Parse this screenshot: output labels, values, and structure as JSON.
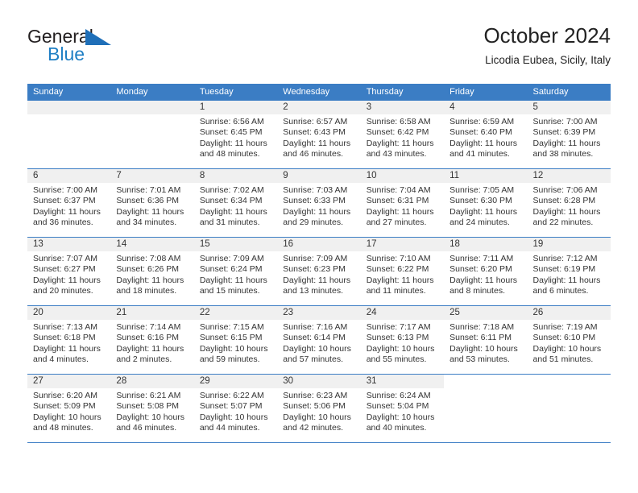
{
  "brand": {
    "word_one": "General",
    "word_two": "Blue",
    "triangle_icon": "triangle-icon"
  },
  "header": {
    "title": "October 2024",
    "subtitle": "Licodia Eubea, Sicily, Italy"
  },
  "colors": {
    "header_blue": "#3b7dc4",
    "brand_blue": "#1f7fc4",
    "daynum_band": "#f0f0f0",
    "text": "#333333"
  },
  "weekday_headers": [
    "Sunday",
    "Monday",
    "Tuesday",
    "Wednesday",
    "Thursday",
    "Friday",
    "Saturday"
  ],
  "labels": {
    "sunrise_prefix": "Sunrise: ",
    "sunset_prefix": "Sunset: ",
    "daylight_prefix": "Daylight: "
  },
  "weeks": [
    [
      {
        "day": "",
        "empty": true
      },
      {
        "day": "",
        "empty": true
      },
      {
        "day": "1",
        "sunrise": "Sunrise: 6:56 AM",
        "sunset": "Sunset: 6:45 PM",
        "daylight": "Daylight: 11 hours and 48 minutes."
      },
      {
        "day": "2",
        "sunrise": "Sunrise: 6:57 AM",
        "sunset": "Sunset: 6:43 PM",
        "daylight": "Daylight: 11 hours and 46 minutes."
      },
      {
        "day": "3",
        "sunrise": "Sunrise: 6:58 AM",
        "sunset": "Sunset: 6:42 PM",
        "daylight": "Daylight: 11 hours and 43 minutes."
      },
      {
        "day": "4",
        "sunrise": "Sunrise: 6:59 AM",
        "sunset": "Sunset: 6:40 PM",
        "daylight": "Daylight: 11 hours and 41 minutes."
      },
      {
        "day": "5",
        "sunrise": "Sunrise: 7:00 AM",
        "sunset": "Sunset: 6:39 PM",
        "daylight": "Daylight: 11 hours and 38 minutes."
      }
    ],
    [
      {
        "day": "6",
        "sunrise": "Sunrise: 7:00 AM",
        "sunset": "Sunset: 6:37 PM",
        "daylight": "Daylight: 11 hours and 36 minutes."
      },
      {
        "day": "7",
        "sunrise": "Sunrise: 7:01 AM",
        "sunset": "Sunset: 6:36 PM",
        "daylight": "Daylight: 11 hours and 34 minutes."
      },
      {
        "day": "8",
        "sunrise": "Sunrise: 7:02 AM",
        "sunset": "Sunset: 6:34 PM",
        "daylight": "Daylight: 11 hours and 31 minutes."
      },
      {
        "day": "9",
        "sunrise": "Sunrise: 7:03 AM",
        "sunset": "Sunset: 6:33 PM",
        "daylight": "Daylight: 11 hours and 29 minutes."
      },
      {
        "day": "10",
        "sunrise": "Sunrise: 7:04 AM",
        "sunset": "Sunset: 6:31 PM",
        "daylight": "Daylight: 11 hours and 27 minutes."
      },
      {
        "day": "11",
        "sunrise": "Sunrise: 7:05 AM",
        "sunset": "Sunset: 6:30 PM",
        "daylight": "Daylight: 11 hours and 24 minutes."
      },
      {
        "day": "12",
        "sunrise": "Sunrise: 7:06 AM",
        "sunset": "Sunset: 6:28 PM",
        "daylight": "Daylight: 11 hours and 22 minutes."
      }
    ],
    [
      {
        "day": "13",
        "sunrise": "Sunrise: 7:07 AM",
        "sunset": "Sunset: 6:27 PM",
        "daylight": "Daylight: 11 hours and 20 minutes."
      },
      {
        "day": "14",
        "sunrise": "Sunrise: 7:08 AM",
        "sunset": "Sunset: 6:26 PM",
        "daylight": "Daylight: 11 hours and 18 minutes."
      },
      {
        "day": "15",
        "sunrise": "Sunrise: 7:09 AM",
        "sunset": "Sunset: 6:24 PM",
        "daylight": "Daylight: 11 hours and 15 minutes."
      },
      {
        "day": "16",
        "sunrise": "Sunrise: 7:09 AM",
        "sunset": "Sunset: 6:23 PM",
        "daylight": "Daylight: 11 hours and 13 minutes."
      },
      {
        "day": "17",
        "sunrise": "Sunrise: 7:10 AM",
        "sunset": "Sunset: 6:22 PM",
        "daylight": "Daylight: 11 hours and 11 minutes."
      },
      {
        "day": "18",
        "sunrise": "Sunrise: 7:11 AM",
        "sunset": "Sunset: 6:20 PM",
        "daylight": "Daylight: 11 hours and 8 minutes."
      },
      {
        "day": "19",
        "sunrise": "Sunrise: 7:12 AM",
        "sunset": "Sunset: 6:19 PM",
        "daylight": "Daylight: 11 hours and 6 minutes."
      }
    ],
    [
      {
        "day": "20",
        "sunrise": "Sunrise: 7:13 AM",
        "sunset": "Sunset: 6:18 PM",
        "daylight": "Daylight: 11 hours and 4 minutes."
      },
      {
        "day": "21",
        "sunrise": "Sunrise: 7:14 AM",
        "sunset": "Sunset: 6:16 PM",
        "daylight": "Daylight: 11 hours and 2 minutes."
      },
      {
        "day": "22",
        "sunrise": "Sunrise: 7:15 AM",
        "sunset": "Sunset: 6:15 PM",
        "daylight": "Daylight: 10 hours and 59 minutes."
      },
      {
        "day": "23",
        "sunrise": "Sunrise: 7:16 AM",
        "sunset": "Sunset: 6:14 PM",
        "daylight": "Daylight: 10 hours and 57 minutes."
      },
      {
        "day": "24",
        "sunrise": "Sunrise: 7:17 AM",
        "sunset": "Sunset: 6:13 PM",
        "daylight": "Daylight: 10 hours and 55 minutes."
      },
      {
        "day": "25",
        "sunrise": "Sunrise: 7:18 AM",
        "sunset": "Sunset: 6:11 PM",
        "daylight": "Daylight: 10 hours and 53 minutes."
      },
      {
        "day": "26",
        "sunrise": "Sunrise: 7:19 AM",
        "sunset": "Sunset: 6:10 PM",
        "daylight": "Daylight: 10 hours and 51 minutes."
      }
    ],
    [
      {
        "day": "27",
        "sunrise": "Sunrise: 6:20 AM",
        "sunset": "Sunset: 5:09 PM",
        "daylight": "Daylight: 10 hours and 48 minutes."
      },
      {
        "day": "28",
        "sunrise": "Sunrise: 6:21 AM",
        "sunset": "Sunset: 5:08 PM",
        "daylight": "Daylight: 10 hours and 46 minutes."
      },
      {
        "day": "29",
        "sunrise": "Sunrise: 6:22 AM",
        "sunset": "Sunset: 5:07 PM",
        "daylight": "Daylight: 10 hours and 44 minutes."
      },
      {
        "day": "30",
        "sunrise": "Sunrise: 6:23 AM",
        "sunset": "Sunset: 5:06 PM",
        "daylight": "Daylight: 10 hours and 42 minutes."
      },
      {
        "day": "31",
        "sunrise": "Sunrise: 6:24 AM",
        "sunset": "Sunset: 5:04 PM",
        "daylight": "Daylight: 10 hours and 40 minutes."
      },
      {
        "day": "",
        "empty": true,
        "no_band": true
      },
      {
        "day": "",
        "empty": true,
        "no_band": true
      }
    ]
  ]
}
